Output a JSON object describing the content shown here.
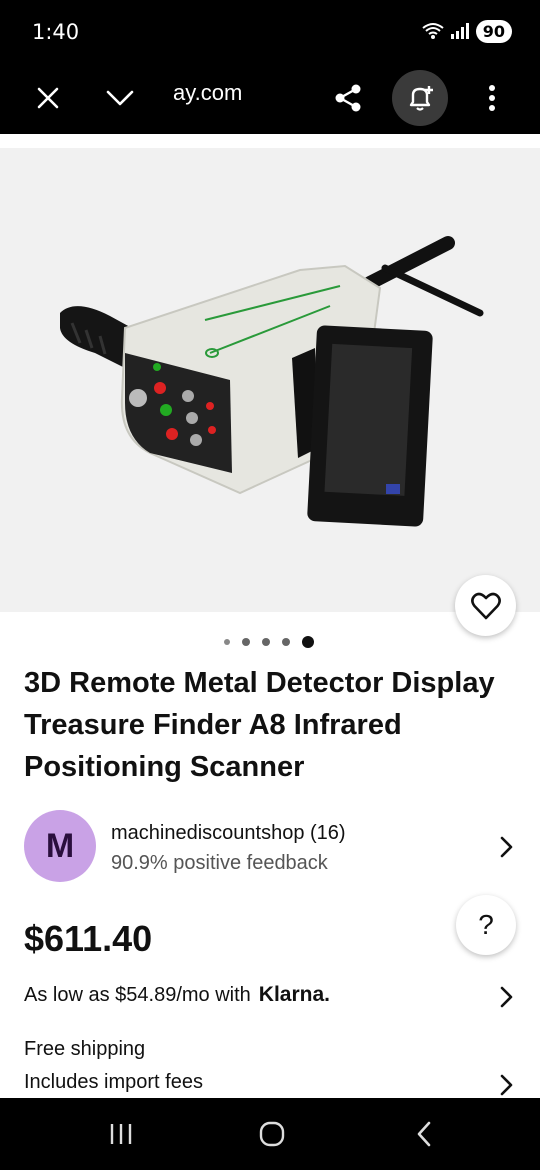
{
  "status_bar": {
    "time": "1:40",
    "battery": "90"
  },
  "toolbar": {
    "url_fragment": "ay.com",
    "close_icon": "close-icon",
    "tabs_icon": "chevron-down-icon",
    "share_icon": "share-icon",
    "add_alert_icon": "bell-plus-icon",
    "menu_icon": "more-vertical-icon"
  },
  "gallery": {
    "image_count": 5,
    "active_index": 4
  },
  "product": {
    "title": "3D Remote Metal Detector Display Treasure Finder A8 Infrared Positioning Scanner",
    "price": "$611.40"
  },
  "seller": {
    "initial": "M",
    "name": "machinediscountshop (16)",
    "feedback": "90.9% positive feedback"
  },
  "financing": {
    "text": "As low as $54.89/mo with",
    "provider": "Klarna."
  },
  "shipping": {
    "line1": "Free shipping",
    "line2": "Includes import fees"
  },
  "help": {
    "label": "?"
  },
  "colors": {
    "avatar_bg": "#c9a2e6",
    "bar_bg": "#000000"
  }
}
